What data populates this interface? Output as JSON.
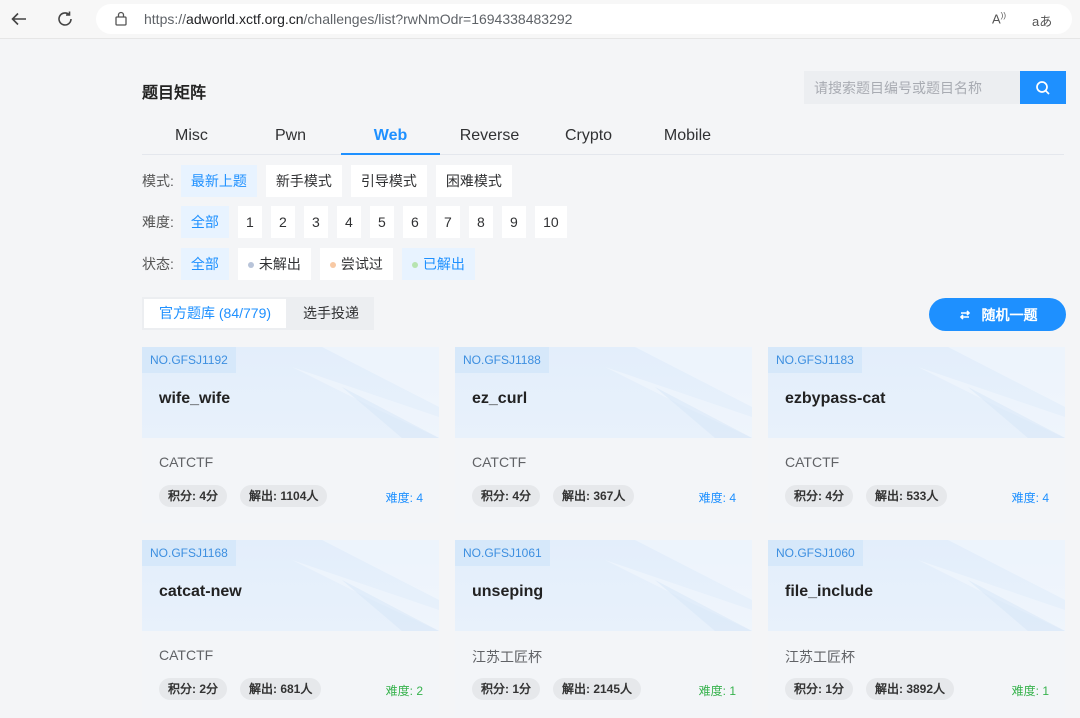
{
  "browser": {
    "url_prefix": "https://",
    "url_host": "adworld.xctf.org.cn",
    "url_path": "/challenges/list?rwNmOdr=1694338483292",
    "read_aloud_icon": "A",
    "translate_icon": "aあ"
  },
  "header": {
    "title": "题目矩阵",
    "search_placeholder": "请搜索题目编号或题目名称"
  },
  "tabs": [
    {
      "label": "Misc",
      "active": false
    },
    {
      "label": "Pwn",
      "active": false
    },
    {
      "label": "Web",
      "active": true
    },
    {
      "label": "Reverse",
      "active": false
    },
    {
      "label": "Crypto",
      "active": false
    },
    {
      "label": "Mobile",
      "active": false
    }
  ],
  "filters": {
    "mode": {
      "label": "模式:",
      "options": [
        "最新上题",
        "新手模式",
        "引导模式",
        "困难模式"
      ],
      "active": 0
    },
    "difficulty": {
      "label": "难度:",
      "options": [
        "全部",
        "1",
        "2",
        "3",
        "4",
        "5",
        "6",
        "7",
        "8",
        "9",
        "10"
      ],
      "active": 0
    },
    "status": {
      "label": "状态:",
      "options": [
        {
          "text": "全部",
          "dot": ""
        },
        {
          "text": "未解出",
          "dot": "#b8c4d9"
        },
        {
          "text": "尝试过",
          "dot": "#f8c9a4"
        },
        {
          "text": "已解出",
          "dot": "#b7e4b0"
        }
      ],
      "active": [
        0,
        3
      ]
    }
  },
  "source_tabs": [
    "官方题库 (84/779)",
    "选手投递"
  ],
  "random_button": "随机一题",
  "colors": {
    "accent": "#1e90ff",
    "diff_blue": "#1e90ff",
    "diff_green": "#37b24d"
  },
  "cards": [
    {
      "no": "NO.GFSJ1192",
      "name": "wife_wife",
      "source": "CATCTF",
      "score": "积分: 4分",
      "solves": "解出: 1104人",
      "difficulty": "难度: 4",
      "diff_color": "#1e90ff"
    },
    {
      "no": "NO.GFSJ1188",
      "name": "ez_curl",
      "source": "CATCTF",
      "score": "积分: 4分",
      "solves": "解出: 367人",
      "difficulty": "难度: 4",
      "diff_color": "#1e90ff"
    },
    {
      "no": "NO.GFSJ1183",
      "name": "ezbypass-cat",
      "source": "CATCTF",
      "score": "积分: 4分",
      "solves": "解出: 533人",
      "difficulty": "难度: 4",
      "diff_color": "#1e90ff"
    },
    {
      "no": "NO.GFSJ1168",
      "name": "catcat-new",
      "source": "CATCTF",
      "score": "积分: 2分",
      "solves": "解出: 681人",
      "difficulty": "难度: 2",
      "diff_color": "#37b24d"
    },
    {
      "no": "NO.GFSJ1061",
      "name": "unseping",
      "source": "江苏工匠杯",
      "score": "积分: 1分",
      "solves": "解出: 2145人",
      "difficulty": "难度: 1",
      "diff_color": "#37b24d"
    },
    {
      "no": "NO.GFSJ1060",
      "name": "file_include",
      "source": "江苏工匠杯",
      "score": "积分: 1分",
      "solves": "解出: 3892人",
      "difficulty": "难度: 1",
      "diff_color": "#37b24d"
    }
  ]
}
